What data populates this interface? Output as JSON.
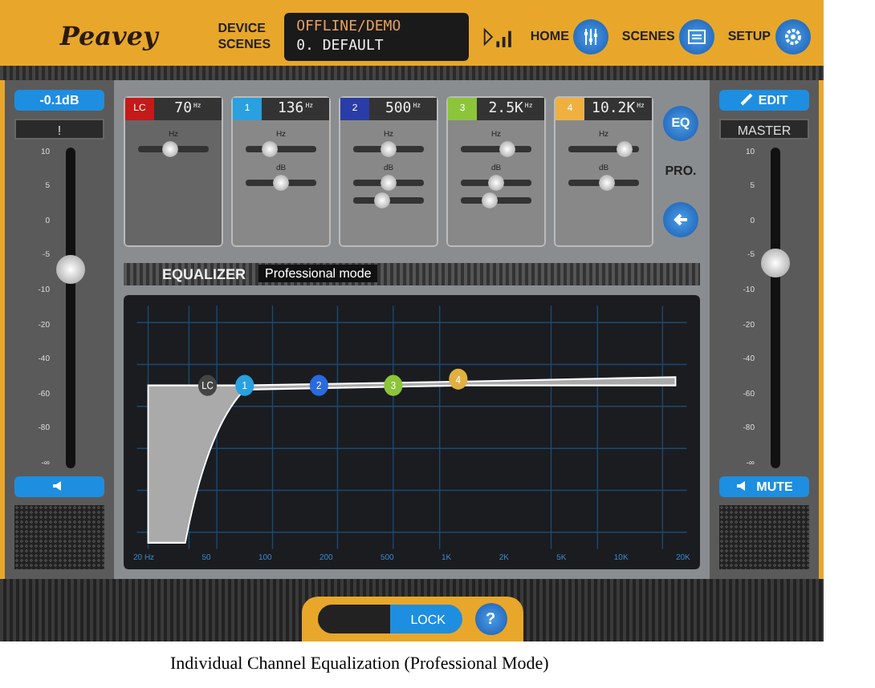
{
  "header": {
    "logo": "Peavey",
    "device_label": "DEVICE",
    "scenes_label": "SCENES",
    "status": "OFFLINE/DEMO",
    "scene": "0. DEFAULT",
    "nav": [
      {
        "label": "HOME",
        "kind": "home"
      },
      {
        "label": "SCENES",
        "kind": "scenes"
      },
      {
        "label": "SETUP",
        "kind": "setup"
      }
    ]
  },
  "channel_strip": {
    "gain": "-0.1dB",
    "name": "!",
    "scale": [
      "10",
      "5",
      "0",
      "-5",
      "-10",
      "-20",
      "-40",
      "-60",
      "-80",
      "-∞"
    ],
    "fader": {
      "level": 0.62
    },
    "muted": false
  },
  "bands": [
    {
      "tag": "LC",
      "value": "70",
      "unit": "Hz",
      "color": "#c41a1a",
      "sliders": [
        {
          "label": "Hz",
          "level": 0.45
        }
      ]
    },
    {
      "tag": "1",
      "value": "136",
      "unit": "Hz",
      "color": "#2aa0e0",
      "sliders": [
        {
          "label": "Hz",
          "level": 0.35
        },
        {
          "label": "dB",
          "level": 0.5
        }
      ]
    },
    {
      "tag": "2",
      "value": "500",
      "unit": "Hz",
      "color": "#2a3ca8",
      "sliders": [
        {
          "label": "Hz",
          "level": 0.5
        },
        {
          "label": "dB",
          "level": 0.5
        },
        {
          "level": 0.4
        }
      ]
    },
    {
      "tag": "3",
      "value": "2.5K",
      "unit": "Hz",
      "color": "#8cc43a",
      "sliders": [
        {
          "label": "Hz",
          "level": 0.65
        },
        {
          "label": "dB",
          "level": 0.5
        },
        {
          "level": 0.4
        }
      ]
    },
    {
      "tag": "4",
      "value": "10.2K",
      "unit": "Hz",
      "color": "#f0b040",
      "sliders": [
        {
          "label": "Hz",
          "level": 0.8
        },
        {
          "label": "dB",
          "level": 0.55
        }
      ]
    }
  ],
  "eq_side": {
    "eq_button": "EQ",
    "mode": "PRO."
  },
  "equalizer": {
    "title": "EQUALIZER",
    "mode": "Professional mode",
    "x_labels": [
      "20 Hz",
      "50",
      "100",
      "200",
      "500",
      "1K",
      "2K",
      "5K",
      "10K",
      "20K"
    ],
    "nodes": [
      {
        "label": "LC",
        "color": "#444444"
      },
      {
        "label": "1",
        "color": "#2aa0e0"
      },
      {
        "label": "2",
        "color": "#2a6ae0"
      },
      {
        "label": "3",
        "color": "#8cc43a"
      },
      {
        "label": "4",
        "color": "#e0b040"
      }
    ]
  },
  "master_strip": {
    "edit": "EDIT",
    "name": "MASTER",
    "scale": [
      "10",
      "5",
      "0",
      "-5",
      "-10",
      "-20",
      "-40",
      "-60",
      "-80",
      "-∞"
    ],
    "fader": {
      "level": 0.64
    },
    "mute": "MUTE"
  },
  "footer": {
    "lock": "LOCK",
    "help": "?"
  },
  "caption": "Individual Channel Equalization (Professional Mode)"
}
